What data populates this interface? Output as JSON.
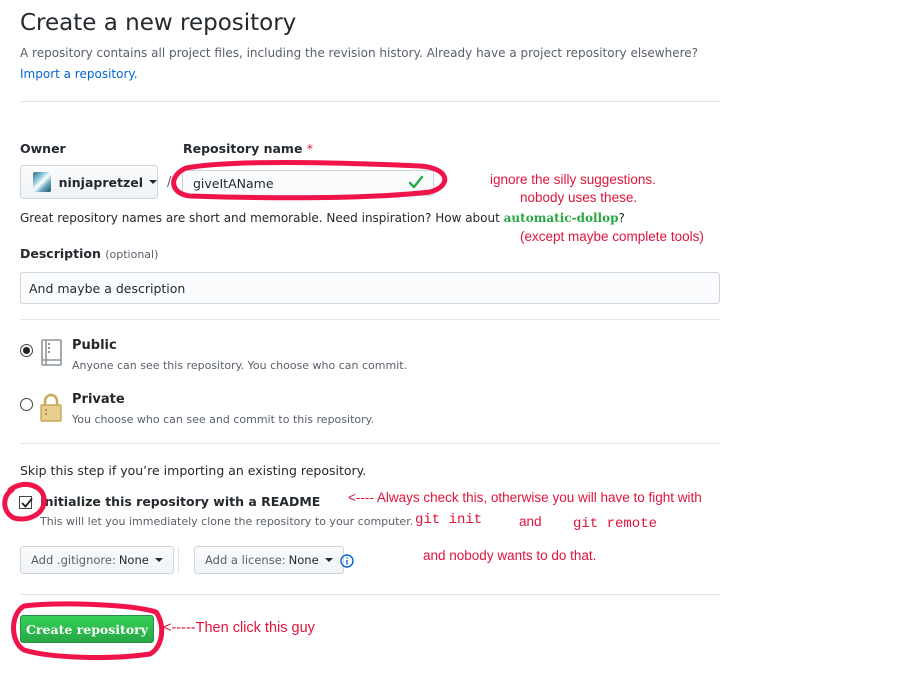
{
  "header": {
    "title": "Create a new repository",
    "subtitle": "A repository contains all project files, including the revision history. Already have a project repository elsewhere?",
    "import_link": "Import a repository."
  },
  "owner": {
    "label": "Owner",
    "value": "ninjapretzel"
  },
  "repo_name": {
    "label": "Repository name",
    "required_mark": "*",
    "separator": "/",
    "value": "giveItAName",
    "hint_prefix": "Great repository names are short and memorable. Need inspiration? How about",
    "suggestion": "automatic-dollop",
    "hint_suffix": "?"
  },
  "description": {
    "label": "Description",
    "optional": "(optional)",
    "value": "And maybe a description"
  },
  "visibility": {
    "public": {
      "title": "Public",
      "desc": "Anyone can see this repository. You choose who can commit.",
      "selected": true
    },
    "private": {
      "title": "Private",
      "desc": "You choose who can see and commit to this repository.",
      "selected": false
    }
  },
  "init": {
    "skip_text": "Skip this step if you’re importing an existing repository.",
    "readme_label": "Initialize this repository with a README",
    "readme_desc": "This will let you immediately clone the repository to your computer.",
    "checked": true
  },
  "selects": {
    "gitignore_prefix": "Add .gitignore:",
    "gitignore_value": "None",
    "license_prefix": "Add a license:",
    "license_value": "None"
  },
  "create_button": "Create repository",
  "annotations": {
    "suggest_1": "ignore the silly suggestions.",
    "suggest_2": "nobody uses these.",
    "suggest_3": "(except maybe complete tools)",
    "readme_note": "<---- Always check this, otherwise you will have to fight with",
    "git_init": "git init",
    "and": "and",
    "git_remote": "git remote",
    "nobody_wants": "and nobody wants to do that.",
    "click_note": "<-----Then click this guy"
  },
  "colors": {
    "accent_link": "#0366d6",
    "create_button_green": "#28a745",
    "annotation_red": "#e0143c"
  },
  "icons": {
    "owner_avatar": "avatar",
    "valid_check": "check-icon",
    "public_repo": "book-icon",
    "private_repo": "lock-icon",
    "info": "info-icon",
    "dropdown": "caret-down-icon"
  }
}
